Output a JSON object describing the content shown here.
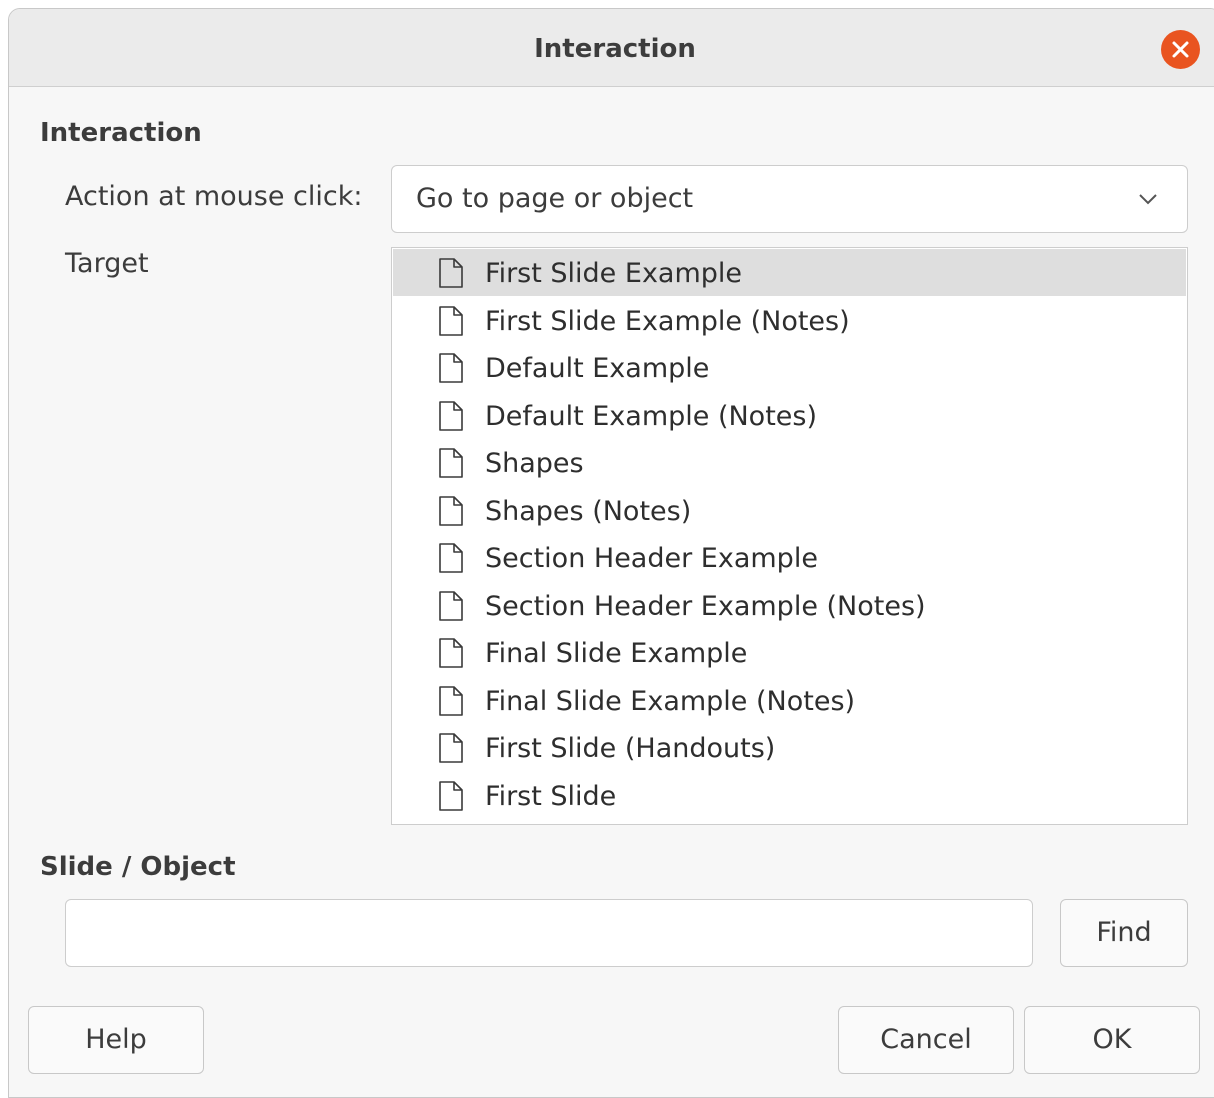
{
  "window": {
    "title": "Interaction",
    "close_icon": "close-icon"
  },
  "interaction_section": {
    "heading": "Interaction",
    "action_label": "Action at mouse click:",
    "action_value": "Go to page or object",
    "target_label": "Target",
    "targets": [
      {
        "label": "First Slide Example",
        "selected": true
      },
      {
        "label": "First Slide Example (Notes)",
        "selected": false
      },
      {
        "label": "Default Example",
        "selected": false
      },
      {
        "label": "Default Example (Notes)",
        "selected": false
      },
      {
        "label": "Shapes",
        "selected": false
      },
      {
        "label": "Shapes (Notes)",
        "selected": false
      },
      {
        "label": "Section Header Example",
        "selected": false
      },
      {
        "label": "Section Header Example (Notes)",
        "selected": false
      },
      {
        "label": "Final Slide Example",
        "selected": false
      },
      {
        "label": "Final Slide Example (Notes)",
        "selected": false
      },
      {
        "label": "First Slide (Handouts)",
        "selected": false
      },
      {
        "label": "First Slide",
        "selected": false
      }
    ]
  },
  "slide_object_section": {
    "heading": "Slide / Object",
    "value": "",
    "find_label": "Find"
  },
  "footer": {
    "help_label": "Help",
    "cancel_label": "Cancel",
    "ok_label": "OK"
  },
  "colors": {
    "close_button": "#e95420",
    "selected_row": "#dedede",
    "titlebar": "#ebebeb"
  }
}
